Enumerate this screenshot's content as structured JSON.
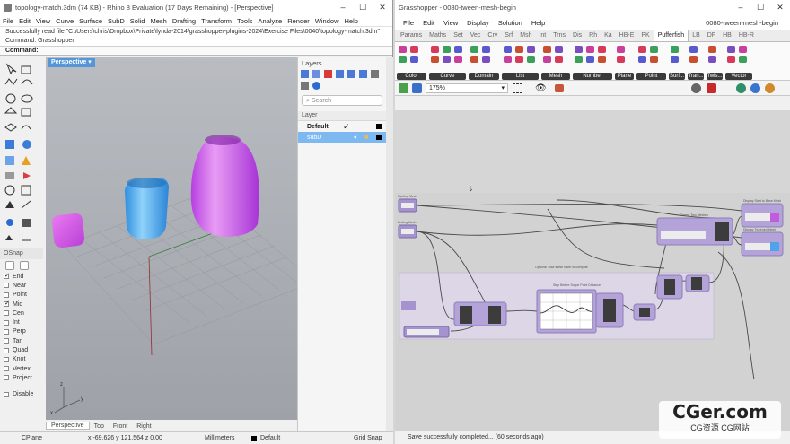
{
  "rhino": {
    "title": "topology-match.3dm (74 KB) - Rhino 8 Evaluation (17 Days Remaining) - [Perspective]",
    "menu": [
      "File",
      "Edit",
      "View",
      "Curve",
      "Surface",
      "SubD",
      "Solid",
      "Mesh",
      "Drafting",
      "Transform",
      "Tools",
      "Analyze",
      "Render",
      "Window",
      "Help"
    ],
    "history_line1": "Successfully read file \"C:\\Users\\chris\\Dropbox\\Private\\lynda-2014\\grasshopper-plugins-2024\\Exercise Files\\0040\\topology-match.3dm\"",
    "history_line2": "Command: Grasshopper",
    "command_prompt": "Command:",
    "viewport_title": "Perspective",
    "viewport_tabs": [
      "Perspective",
      "Top",
      "Front",
      "Right"
    ],
    "osnap": {
      "title": "OSnap",
      "items": [
        {
          "label": "End",
          "checked": true
        },
        {
          "label": "Near",
          "checked": false
        },
        {
          "label": "Point",
          "checked": false
        },
        {
          "label": "Mid",
          "checked": true
        },
        {
          "label": "Cen",
          "checked": false
        },
        {
          "label": "Int",
          "checked": false
        },
        {
          "label": "Perp",
          "checked": false
        },
        {
          "label": "Tan",
          "checked": false
        },
        {
          "label": "Quad",
          "checked": false
        },
        {
          "label": "Knot",
          "checked": false
        },
        {
          "label": "Vertex",
          "checked": false
        },
        {
          "label": "Project",
          "checked": false
        },
        {
          "label": "Disable",
          "checked": false
        }
      ]
    },
    "layers": {
      "title": "Layers",
      "search_placeholder": "Search",
      "column": "Layer",
      "rows": [
        {
          "name": "Default",
          "current": true
        },
        {
          "name": "subD",
          "current": false
        }
      ]
    },
    "status": {
      "cplane": "CPlane",
      "coords": "x -69.626   y 121.564   z 0.00",
      "units": "Millimeters",
      "layer": "Default",
      "grid_snap": "Grid Snap"
    },
    "objects": [
      {
        "name": "small-cube",
        "color": "#d84ee6"
      },
      {
        "name": "medium-box",
        "color": "#3ca6ec"
      },
      {
        "name": "tall-vase",
        "color": "#c24ae8"
      }
    ]
  },
  "gh": {
    "title": "Grasshopper - 0080-tween-mesh-begin",
    "menu": [
      "File",
      "Edit",
      "View",
      "Display",
      "Solution",
      "Help"
    ],
    "doc_name": "0080-tween-mesh-begin",
    "tabs": [
      "Params",
      "Maths",
      "Set",
      "Vec",
      "Crv",
      "Srf",
      "Msh",
      "Int",
      "Trns",
      "Dis",
      "Rh",
      "Ka",
      "HB-E",
      "PK",
      "Pufferfish",
      "LB",
      "DF",
      "HB",
      "HB-R"
    ],
    "active_tab": "Pufferfish",
    "ribbon_groups": [
      "Color",
      "Curve",
      "Domain",
      "List",
      "Mesh",
      "Number",
      "Plane",
      "Point",
      "Surf...",
      "Tran...",
      "Twis...",
      "Vector"
    ],
    "zoom": "175%",
    "status_message": "Save successfully completed... (60 seconds ago)",
    "colors": {
      "node_purple": "#a68fd1",
      "group_lilac": "#dcd5e8",
      "canvas": "#d2d2d2"
    }
  },
  "watermark": {
    "big": "CGer.com",
    "small": "CG资源 CG网站"
  }
}
